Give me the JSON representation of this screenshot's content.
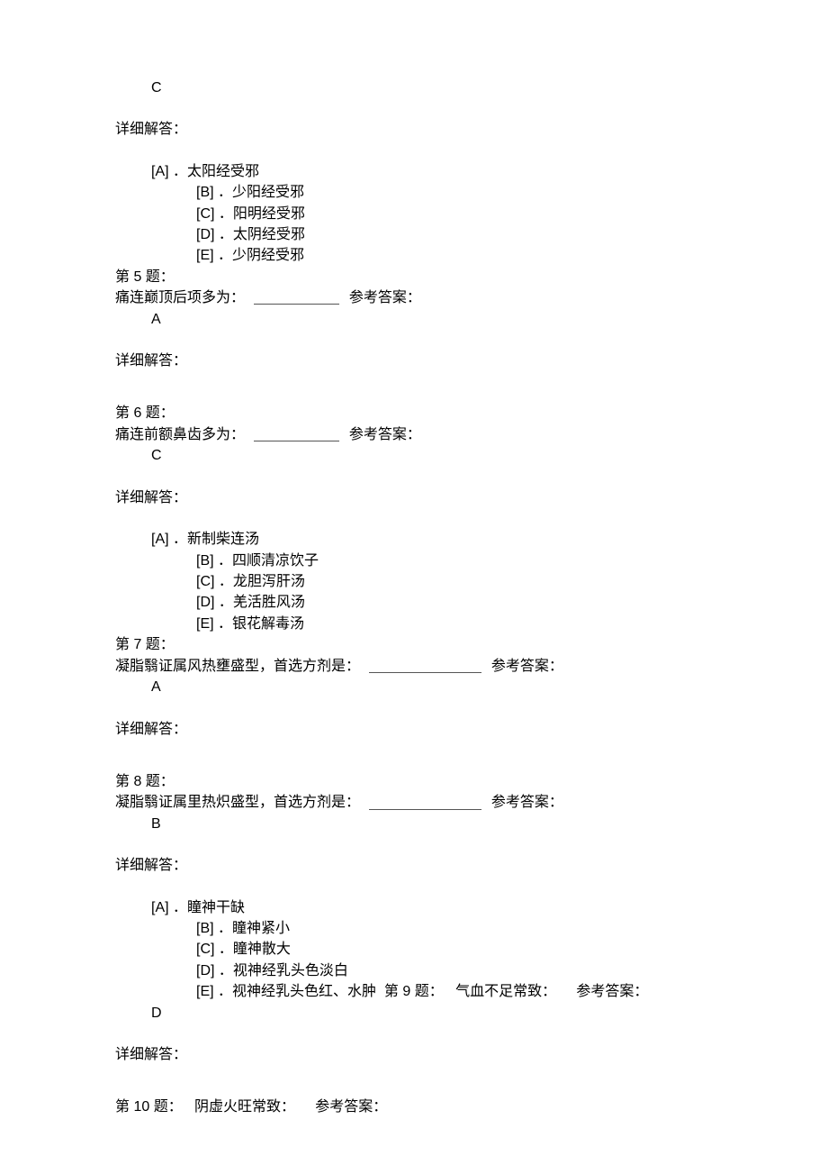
{
  "answer_prev": "C",
  "detail_label": "详细解答：",
  "ref_answer_label": "参考答案：",
  "options_block1": {
    "A": "太阳经受邪",
    "B": "少阳经受邪",
    "C": "阳明经受邪",
    "D": "太阴经受邪",
    "E": "少阴经受邪"
  },
  "q5": {
    "header": "第 5 题：",
    "text": "痛连巅顶后项多为：",
    "answer": "A"
  },
  "q6": {
    "header": "第 6 题：",
    "text": "痛连前额鼻齿多为：",
    "answer": "C"
  },
  "options_block2": {
    "A": "新制柴连汤",
    "B": "四顺清凉饮子",
    "C": "龙胆泻肝汤",
    "D": "羌活胜风汤",
    "E": "银花解毒汤"
  },
  "q7": {
    "header": "第 7 题：",
    "text": "凝脂翳证属风热壅盛型，首选方剂是：",
    "answer": "A"
  },
  "q8": {
    "header": "第 8 题：",
    "text": "凝脂翳证属里热炽盛型，首选方剂是：",
    "answer": "B"
  },
  "options_block3": {
    "A": "瞳神干缺",
    "B": "瞳神紧小",
    "C": "瞳神散大",
    "D": "视神经乳头色淡白",
    "E": "视神经乳头色红、水肿"
  },
  "q9": {
    "header": "第 9 题：",
    "text": "气血不足常致：",
    "answer": "D"
  },
  "q10": {
    "header": "第 10 题：",
    "text": "阴虚火旺常致："
  }
}
